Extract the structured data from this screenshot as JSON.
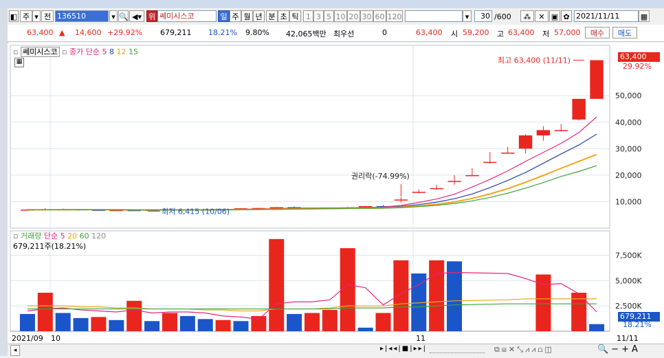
{
  "toolbar": {
    "period_buttons": [
      "주",
      "전"
    ],
    "code": "136510",
    "tag": "위",
    "stock_name": "쎄미시스코",
    "intervals": [
      "일",
      "주",
      "월",
      "년",
      "분",
      "초",
      "틱"
    ],
    "minutes": [
      "1",
      "3",
      "5",
      "10",
      "20",
      "30",
      "60",
      "120"
    ],
    "count": "30",
    "count_total": "/600",
    "date": "2021/11/11"
  },
  "info": {
    "price": "63,400",
    "up_arrow": "▲",
    "change": "14,600",
    "change_pct": "+29.92%",
    "volume": "679,211",
    "vol_ratio": "18.21%",
    "turnover": "9.80%",
    "amount": "42,065백만",
    "best_label": "최우선",
    "best_val": "0",
    "cur": "63,400",
    "open_label": "시",
    "open": "59,200",
    "high_label": "고",
    "high": "63,400",
    "low_label": "저",
    "low": "57,000",
    "buy_label": "매수",
    "sell_label": "매도"
  },
  "price_pane": {
    "stock_label": "쎄미시스코",
    "ma_label": "종가 단순",
    "ma_periods": [
      "5",
      "8",
      "12",
      "15"
    ],
    "ma_colors": [
      "#e8237c",
      "#2a3fb0",
      "#f2a41a",
      "#3fa33a"
    ],
    "yticks": [
      "50,000",
      "40,000",
      "30,000",
      "20,000",
      "10,000"
    ],
    "cur_value": "63,400",
    "cur_pct": "29.92%",
    "annotation_high": "최고 63,400 (11/11)",
    "annotation_ex": "권리락(-74.99%)",
    "annotation_low": "최저 6,415 (10/06)"
  },
  "vol_pane": {
    "title": "거래량",
    "ma_label": "단순",
    "ma_periods": [
      "5",
      "20",
      "60",
      "120"
    ],
    "ma_colors": [
      "#e8237c",
      "#f2a41a",
      "#3fa33a",
      "#8a8a8a"
    ],
    "sub_value": "679,211주(18.21%)",
    "yticks": [
      "7,500K",
      "5,000K",
      "2,500K"
    ],
    "cur_value": "679,211",
    "cur_pct": "18.21%"
  },
  "xaxis": {
    "labels": [
      "2021/09",
      "10",
      "11"
    ],
    "right": "11/11"
  },
  "colors": {
    "up": "#e8261d",
    "down": "#1a56c8",
    "grid": "#dfe5ec"
  },
  "chart_data": [
    {
      "type": "candlestick",
      "x": [
        "09/24",
        "09/27",
        "09/28",
        "09/29",
        "09/30",
        "10/01",
        "10/05",
        "10/06",
        "10/07",
        "10/08",
        "10/12",
        "10/13",
        "10/14",
        "10/15",
        "10/18",
        "10/19",
        "10/20",
        "10/21",
        "10/22",
        "10/25",
        "10/26",
        "10/27",
        "10/28",
        "10/29",
        "11/01",
        "11/02",
        "11/03",
        "11/04",
        "11/05",
        "11/08",
        "11/09",
        "11/10",
        "11/11"
      ],
      "open": [
        7000,
        7000,
        7100,
        7100,
        6900,
        6700,
        6800,
        6600,
        6900,
        7000,
        7000,
        6900,
        7200,
        7500,
        7600,
        7900,
        7500,
        7500,
        7700,
        7800,
        8300,
        10800,
        13700,
        15100,
        17800,
        20000,
        25000,
        28500,
        30000,
        35000,
        37000,
        41000,
        48800
      ],
      "high": [
        7200,
        7600,
        7400,
        7200,
        7100,
        6900,
        6900,
        6800,
        7300,
        7200,
        7100,
        7200,
        7500,
        7700,
        8000,
        8200,
        7800,
        7800,
        8000,
        8400,
        8800,
        11700,
        14600,
        16300,
        20000,
        22600,
        28700,
        30700,
        35500,
        38500,
        39300,
        48800,
        63400
      ],
      "low": [
        6800,
        6900,
        7000,
        6800,
        6700,
        6500,
        6600,
        6415,
        6800,
        6800,
        6800,
        6800,
        7000,
        7200,
        7400,
        7400,
        7300,
        7300,
        7500,
        7600,
        7900,
        9600,
        13200,
        14400,
        16400,
        19600,
        24300,
        28400,
        28200,
        33000,
        36500,
        40600,
        57000
      ],
      "close": [
        7000,
        7100,
        7100,
        6900,
        6700,
        6800,
        6600,
        6900,
        7000,
        7000,
        6900,
        7200,
        7500,
        7600,
        7900,
        7500,
        7500,
        7700,
        7800,
        8300,
        7900,
        10800,
        13700,
        15100,
        17800,
        20000,
        25000,
        28500,
        35000,
        37000,
        37000,
        48800,
        63400
      ],
      "ma_series": [
        {
          "name": "5",
          "values": [
            6900,
            6950,
            7000,
            7050,
            6950,
            6900,
            6800,
            6800,
            6850,
            6900,
            7000,
            7050,
            7150,
            7250,
            7400,
            7550,
            7600,
            7650,
            7700,
            7800,
            7950,
            8600,
            9700,
            11000,
            12800,
            15500,
            18400,
            21600,
            25200,
            28600,
            32000,
            36100,
            42000
          ]
        },
        {
          "name": "8",
          "values": [
            6900,
            6920,
            6950,
            6980,
            6950,
            6900,
            6850,
            6820,
            6850,
            6880,
            6920,
            7000,
            7050,
            7150,
            7250,
            7350,
            7450,
            7550,
            7650,
            7700,
            7750,
            8200,
            8900,
            9800,
            11100,
            12900,
            15300,
            18000,
            21000,
            24500,
            28000,
            31400,
            35500
          ]
        },
        {
          "name": "12",
          "values": [
            6950,
            6950,
            6970,
            6980,
            6960,
            6930,
            6890,
            6860,
            6860,
            6880,
            6900,
            6940,
            7000,
            7070,
            7160,
            7260,
            7340,
            7420,
            7500,
            7560,
            7620,
            7900,
            8400,
            9000,
            9900,
            11200,
            12900,
            14900,
            17300,
            19900,
            22600,
            25200,
            27800
          ]
        },
        {
          "name": "15",
          "values": [
            6950,
            6950,
            6960,
            6970,
            6960,
            6940,
            6900,
            6880,
            6870,
            6880,
            6890,
            6920,
            6960,
            7020,
            7090,
            7180,
            7260,
            7330,
            7400,
            7460,
            7520,
            7720,
            8100,
            8600,
            9300,
            10300,
            11600,
            13200,
            15100,
            17200,
            19500,
            21400,
            23600
          ]
        }
      ],
      "ylim": [
        0,
        63400
      ]
    },
    {
      "type": "bar",
      "title": "거래량",
      "x": [
        "09/24",
        "09/27",
        "09/28",
        "09/29",
        "09/30",
        "10/01",
        "10/05",
        "10/06",
        "10/07",
        "10/08",
        "10/12",
        "10/13",
        "10/14",
        "10/15",
        "10/18",
        "10/19",
        "10/20",
        "10/21",
        "10/22",
        "10/25",
        "10/26",
        "10/27",
        "10/28",
        "10/29",
        "11/01",
        "11/02",
        "11/03",
        "11/04",
        "11/05",
        "11/08",
        "11/09",
        "11/10",
        "11/11"
      ],
      "values": [
        1700,
        3800,
        1800,
        1300,
        1400,
        1100,
        3000,
        1000,
        1800,
        1500,
        1200,
        1100,
        1000,
        1500,
        9100,
        1700,
        1800,
        2100,
        8200,
        350,
        1800,
        7000,
        5700,
        7000,
        6900,
        null,
        null,
        5600,
        null,
        3800,
        700
      ],
      "up": [
        false,
        true,
        false,
        false,
        true,
        false,
        true,
        false,
        true,
        false,
        false,
        true,
        false,
        true,
        true,
        false,
        true,
        true,
        true,
        false,
        true,
        true,
        false,
        true,
        false,
        null,
        null,
        true,
        null,
        true,
        false
      ],
      "ma_series": [
        {
          "name": "5",
          "values": [
            2000,
            2200,
            2300,
            2100,
            2000,
            1900,
            2100,
            1800,
            1900,
            1900,
            1800,
            1500,
            1400,
            1200,
            2700,
            2900,
            2900,
            3100,
            4600,
            4300,
            2600,
            3700,
            4600,
            5700,
            5800,
            5700,
            5200,
            4600,
            4700,
            3700,
            1900
          ]
        },
        {
          "name": "20",
          "values": [
            2500,
            2500,
            2500,
            2400,
            2400,
            2300,
            2300,
            2200,
            2200,
            2200,
            2100,
            2100,
            2000,
            2000,
            2200,
            2200,
            2200,
            2300,
            2500,
            2500,
            2500,
            2700,
            2800,
            2900,
            3000,
            3100,
            3200,
            3200,
            3200,
            3200,
            3200
          ]
        },
        {
          "name": "60",
          "values": [
            2200,
            2200,
            2200,
            2200,
            2200,
            2200,
            2200,
            2200,
            2200,
            2200,
            2200,
            2200,
            2200,
            2200,
            2200,
            2200,
            2200,
            2200,
            2300,
            2300,
            2300,
            2400,
            2400,
            2500,
            2600,
            2700,
            2700,
            2700,
            2700,
            2700,
            2700
          ]
        }
      ],
      "ylim": [
        0,
        9500
      ]
    }
  ]
}
